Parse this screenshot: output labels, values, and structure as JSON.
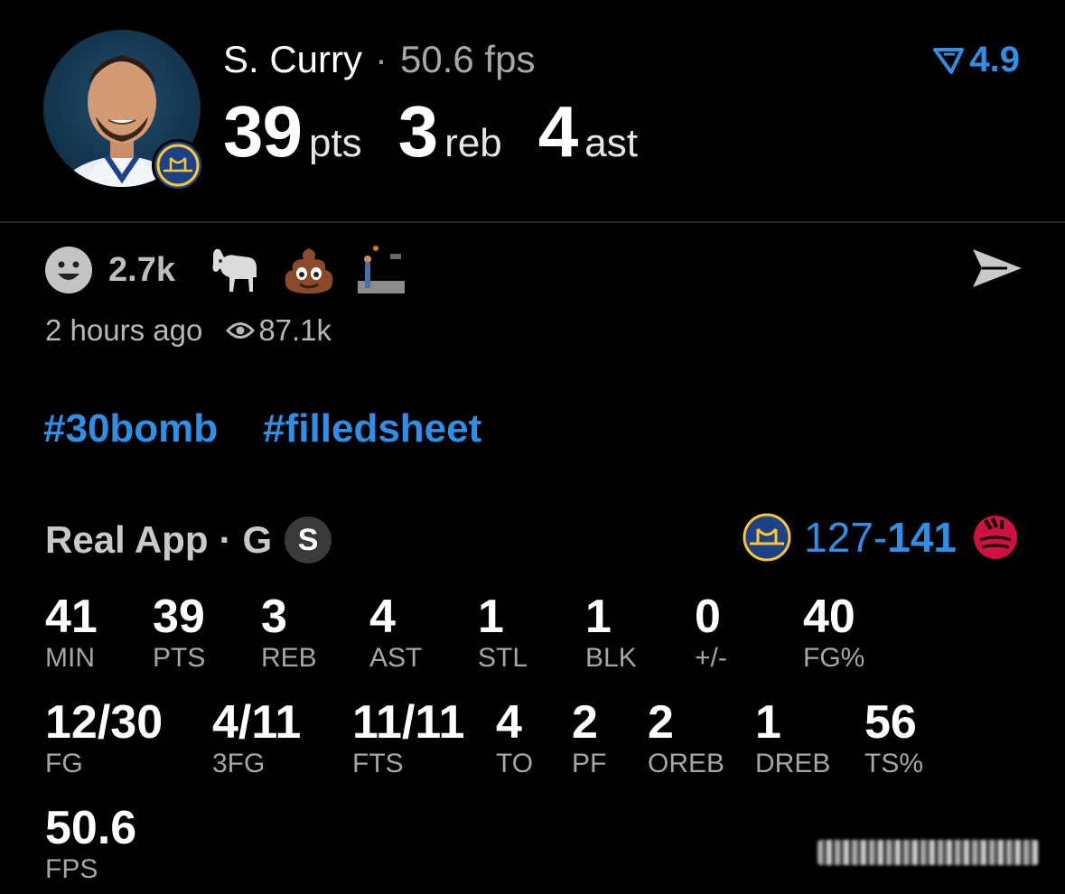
{
  "header": {
    "player_name": "S. Curry",
    "separator": "·",
    "fps_text": "50.6 fps",
    "rating": "4.9",
    "rating_color": "#2f8fe6",
    "stat_line": [
      {
        "value": "39",
        "unit": "pts"
      },
      {
        "value": "3",
        "unit": "reb"
      },
      {
        "value": "4",
        "unit": "ast"
      }
    ],
    "avatar_icon": "player-avatar",
    "team_logo_icon": "warriors-logo"
  },
  "reactions": {
    "count": "2.7k",
    "items": [
      "smiley-icon",
      "goat-icon",
      "poop-icon",
      "photo-icon"
    ],
    "send_icon": "send-icon"
  },
  "meta": {
    "time_ago": "2 hours ago",
    "views": "87.1k"
  },
  "tags": [
    "#30bomb",
    "#filledsheet"
  ],
  "game": {
    "source": "Real App",
    "separator": "·",
    "position": "G",
    "badge": "S",
    "score_home": "127",
    "score_dash": "-",
    "score_away": "141",
    "home_logo": "warriors-logo",
    "away_logo": "raptors-logo"
  },
  "stats_row1": [
    {
      "value": "41",
      "label": "MIN"
    },
    {
      "value": "39",
      "label": "PTS"
    },
    {
      "value": "3",
      "label": "REB"
    },
    {
      "value": "4",
      "label": "AST"
    },
    {
      "value": "1",
      "label": "STL"
    },
    {
      "value": "1",
      "label": "BLK"
    },
    {
      "value": "0",
      "label": "+/-"
    },
    {
      "value": "40",
      "label": "FG%"
    }
  ],
  "stats_row2": [
    {
      "value": "12/30",
      "label": "FG"
    },
    {
      "value": "4/11",
      "label": "3FG"
    },
    {
      "value": "11/11",
      "label": "FTS"
    },
    {
      "value": "4",
      "label": "TO"
    },
    {
      "value": "2",
      "label": "PF"
    },
    {
      "value": "2",
      "label": "OREB"
    },
    {
      "value": "1",
      "label": "DREB"
    },
    {
      "value": "56",
      "label": "TS%"
    }
  ],
  "stats_row3": [
    {
      "value": "50.6",
      "label": "FPS"
    }
  ]
}
